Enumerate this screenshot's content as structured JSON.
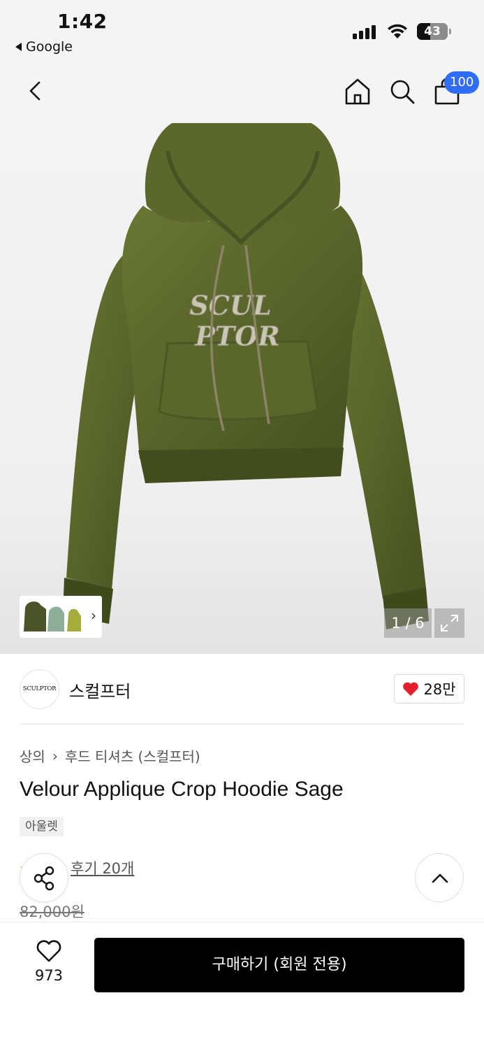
{
  "status_bar": {
    "time": "1:42",
    "back_app": "Google",
    "battery": "43"
  },
  "nav": {
    "cart_count": "100"
  },
  "gallery": {
    "page_indicator": "1 / 6",
    "hoodie_colors": [
      "#5e6a2c",
      "#4f5a25",
      "#3f4a1d"
    ],
    "thumb_colors": [
      "#4a5428",
      "#8fae9a",
      "#a6ad3d"
    ]
  },
  "brand": {
    "logo_text": "SCULPTOR",
    "name": "스컬프터",
    "likes": "28만"
  },
  "product": {
    "breadcrumb": [
      "상의",
      "후드 티셔츠 (스컬프터)"
    ],
    "title": "Velour Applique Crop Hoodie Sage",
    "tag": "아울렛",
    "reviews": "후기 20개",
    "original_price": "82,000원"
  },
  "bottom_bar": {
    "wish_count": "973",
    "buy_label": "구매하기 (회원 전용)"
  },
  "colors": {
    "accent_badge": "#2f6df6",
    "heart": "#e5202e",
    "buy_button": "#000000"
  }
}
